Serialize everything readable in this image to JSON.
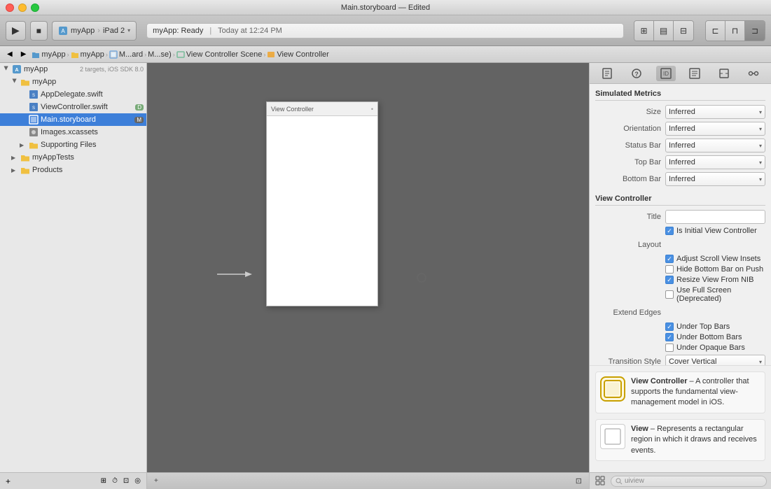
{
  "window": {
    "title": "Main.storyboard — Edited",
    "close_label": "×",
    "minimize_label": "−",
    "maximize_label": "+"
  },
  "toolbar": {
    "run_btn": "▶",
    "stop_btn": "■",
    "scheme_app": "myApp",
    "scheme_device": "iPad 2",
    "status_text": "myApp: Ready",
    "status_sep": "|",
    "status_time": "Today at 12:24 PM",
    "view_btns": [
      "⊞",
      "▤",
      "⊟"
    ],
    "layout_btns": [
      "⊏",
      "⊐",
      "⊓"
    ],
    "panel_btns": [
      "▭",
      "▭",
      "▭"
    ]
  },
  "secondary_toolbar": {
    "back_btn": "◀",
    "fwd_btn": "▶",
    "breadcrumbs": [
      "myApp",
      "myApp",
      "M...ard",
      "M...se)",
      "View Controller Scene",
      "View Controller"
    ]
  },
  "sidebar": {
    "header": "myApp",
    "subheader": "2 targets, iOS SDK 8.0",
    "items": [
      {
        "level": 0,
        "type": "root",
        "open": true,
        "label": "myApp",
        "badge": ""
      },
      {
        "level": 1,
        "type": "folder",
        "open": true,
        "label": "myApp",
        "badge": ""
      },
      {
        "level": 2,
        "type": "swift",
        "label": "AppDelegate.swift",
        "badge": ""
      },
      {
        "level": 2,
        "type": "swift",
        "label": "ViewController.swift",
        "badge": "D"
      },
      {
        "level": 2,
        "type": "storyboard",
        "label": "Main.storyboard",
        "badge": "M",
        "selected": true
      },
      {
        "level": 2,
        "type": "image",
        "label": "Images.xcassets",
        "badge": ""
      },
      {
        "level": 2,
        "type": "folder",
        "label": "Supporting Files",
        "badge": ""
      },
      {
        "level": 1,
        "type": "folder",
        "label": "myAppTests",
        "badge": ""
      },
      {
        "level": 1,
        "type": "folder",
        "label": "Products",
        "badge": ""
      }
    ]
  },
  "canvas": {
    "vc_label": "View Controller",
    "arrow": "→"
  },
  "inspector": {
    "tabs": [
      "□",
      "?",
      "≡",
      "⊞",
      "≡",
      "↔"
    ],
    "simulated_metrics": {
      "header": "Simulated Metrics",
      "size_label": "Size",
      "size_value": "Inferred",
      "orientation_label": "Orientation",
      "orientation_value": "Inferred",
      "status_bar_label": "Status Bar",
      "status_bar_value": "Inferred",
      "top_bar_label": "Top Bar",
      "top_bar_value": "Inferred",
      "bottom_bar_label": "Bottom Bar",
      "bottom_bar_value": "Inferred"
    },
    "view_controller": {
      "header": "View Controller",
      "title_label": "Title",
      "title_value": "",
      "initial_vc_label": "Is Initial View Controller",
      "initial_vc_checked": true,
      "layout_label": "Layout",
      "adjust_scroll_label": "Adjust Scroll View Insets",
      "adjust_scroll_checked": true,
      "hide_bottom_label": "Hide Bottom Bar on Push",
      "hide_bottom_checked": false,
      "resize_nib_label": "Resize View From NIB",
      "resize_nib_checked": true,
      "full_screen_label": "Use Full Screen (Deprecated)",
      "full_screen_checked": false,
      "extend_edges_label": "Extend Edges",
      "under_top_label": "Under Top Bars",
      "under_top_checked": true,
      "under_bottom_label": "Under Bottom Bars",
      "under_bottom_checked": true,
      "under_opaque_label": "Under Opaque Bars",
      "under_opaque_checked": false,
      "transition_label": "Transition Style",
      "transition_value": "Cover Vertical"
    },
    "info_cards": [
      {
        "title": "View Controller",
        "desc": " – A controller that supports the fundamental view-management model in iOS."
      },
      {
        "title": "View",
        "desc": " – Represents a rectangular region in which it draws and receives events."
      }
    ],
    "footer": {
      "search_placeholder": "uiview"
    }
  },
  "status_bar": {
    "left_btn": "+",
    "icons": [
      "⊞",
      "⏱",
      "⊡",
      "◎"
    ]
  }
}
